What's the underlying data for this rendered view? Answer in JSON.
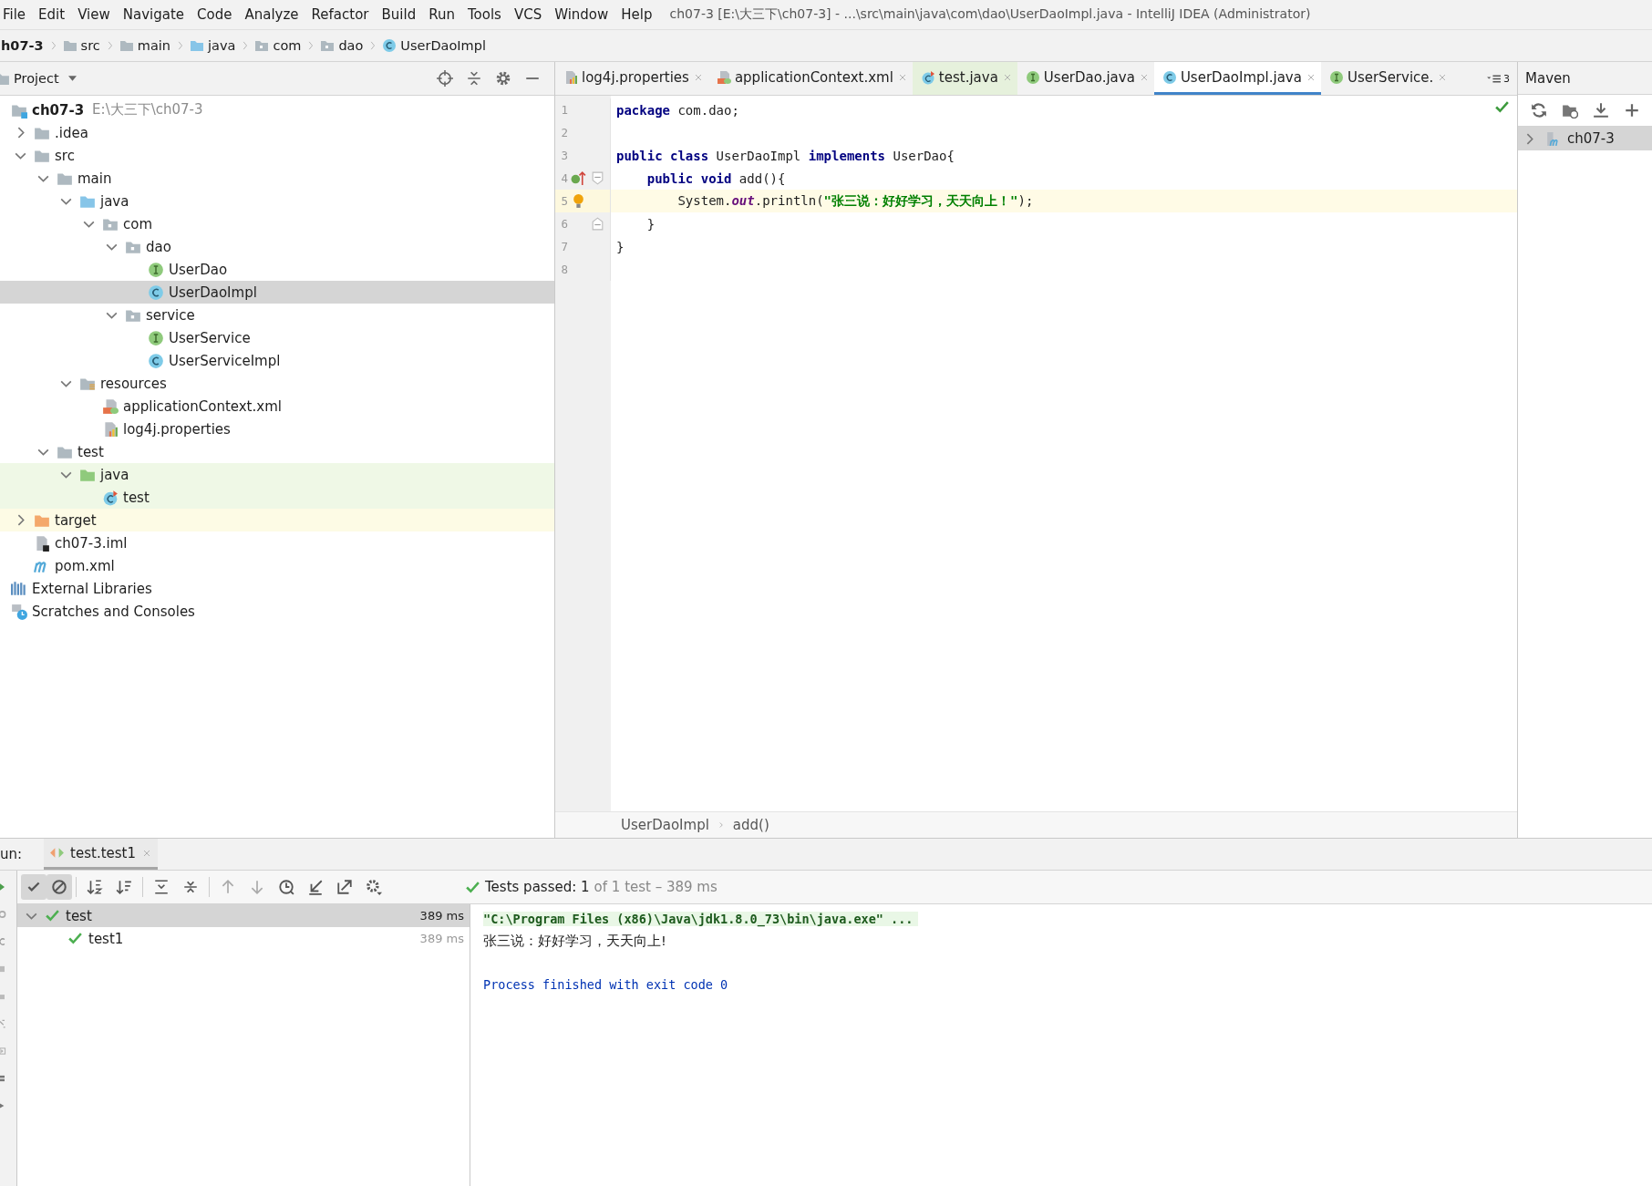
{
  "menu": [
    "File",
    "Edit",
    "View",
    "Navigate",
    "Code",
    "Analyze",
    "Refactor",
    "Build",
    "Run",
    "Tools",
    "VCS",
    "Window",
    "Help"
  ],
  "title": "ch07-3 [E:\\大三下\\ch07-3] - ...\\src\\main\\java\\com\\dao\\UserDaoImpl.java - IntelliJ IDEA (Administrator)",
  "nav_path": [
    {
      "label": "h07-3",
      "kind": "module"
    },
    {
      "label": "src",
      "kind": "folder"
    },
    {
      "label": "main",
      "kind": "folder"
    },
    {
      "label": "java",
      "kind": "source-folder"
    },
    {
      "label": "com",
      "kind": "package"
    },
    {
      "label": "dao",
      "kind": "package"
    },
    {
      "label": "UserDaoImpl",
      "kind": "class"
    }
  ],
  "project_panel": {
    "title": "Project",
    "tree": [
      {
        "label": "ch07-3",
        "path": "E:\\大三下\\ch07-3",
        "kind": "module",
        "selected": false,
        "children": [
          {
            "label": ".idea",
            "kind": "folder",
            "expanded": false,
            "selected": false
          },
          {
            "label": "src",
            "kind": "folder",
            "expanded": true,
            "selected": false,
            "children": [
              {
                "label": "main",
                "kind": "folder",
                "expanded": true,
                "selected": false,
                "children": [
                  {
                    "label": "java",
                    "kind": "source-folder",
                    "expanded": true,
                    "selected": false,
                    "children": [
                      {
                        "label": "com",
                        "kind": "package",
                        "expanded": true,
                        "selected": false,
                        "children": [
                          {
                            "label": "dao",
                            "kind": "package",
                            "expanded": true,
                            "selected": false,
                            "children": [
                              {
                                "label": "UserDao",
                                "kind": "interface",
                                "selected": false
                              },
                              {
                                "label": "UserDaoImpl",
                                "kind": "class",
                                "selected": true
                              }
                            ]
                          },
                          {
                            "label": "service",
                            "kind": "package",
                            "expanded": true,
                            "selected": false,
                            "children": [
                              {
                                "label": "UserService",
                                "kind": "interface",
                                "selected": false
                              },
                              {
                                "label": "UserServiceImpl",
                                "kind": "class",
                                "selected": false
                              }
                            ]
                          }
                        ]
                      }
                    ]
                  },
                  {
                    "label": "resources",
                    "kind": "resource-folder",
                    "expanded": true,
                    "selected": false,
                    "children": [
                      {
                        "label": "applicationContext.xml",
                        "kind": "xml",
                        "selected": false
                      },
                      {
                        "label": "log4j.properties",
                        "kind": "properties",
                        "selected": false
                      }
                    ]
                  }
                ]
              },
              {
                "label": "test",
                "kind": "folder",
                "expanded": true,
                "selected": false,
                "children": [
                  {
                    "label": "java",
                    "kind": "test-folder",
                    "expanded": true,
                    "selected": false,
                    "children": [
                      {
                        "label": "test",
                        "kind": "test-class",
                        "selected": false
                      }
                    ]
                  }
                ]
              }
            ]
          },
          {
            "label": "target",
            "kind": "excluded-folder",
            "expanded": false,
            "selected": false
          },
          {
            "label": "ch07-3.iml",
            "kind": "iml",
            "selected": false
          },
          {
            "label": "pom.xml",
            "kind": "maven",
            "selected": false
          }
        ]
      },
      {
        "label": "External Libraries",
        "kind": "libraries",
        "selected": false
      },
      {
        "label": "Scratches and Consoles",
        "kind": "scratches",
        "selected": false
      }
    ]
  },
  "editor": {
    "tabs": [
      {
        "label": "log4j.properties",
        "kind": "properties",
        "selected": false
      },
      {
        "label": "applicationContext.xml",
        "kind": "xml",
        "selected": false
      },
      {
        "label": "test.java",
        "kind": "test-class",
        "selected": false
      },
      {
        "label": "UserDao.java",
        "kind": "interface",
        "selected": false
      },
      {
        "label": "UserDaoImpl.java",
        "kind": "class",
        "selected": true
      },
      {
        "label": "UserService.",
        "kind": "interface",
        "selected": false
      }
    ],
    "hidden_tabs_count": "3",
    "lines": [
      {
        "number": "1",
        "tokens": [
          {
            "kind": "keyword",
            "text": "package"
          },
          {
            "kind": "plain",
            "text": " com.dao;"
          }
        ]
      },
      {
        "number": "2"
      },
      {
        "number": "3",
        "tokens": [
          {
            "kind": "keyword",
            "text": "public class"
          },
          {
            "kind": "plain",
            "text": " UserDaoImpl "
          },
          {
            "kind": "keyword",
            "text": "implements"
          },
          {
            "kind": "plain",
            "text": " UserDao{"
          }
        ]
      },
      {
        "number": "4",
        "implements_marker": true,
        "fold_start": true,
        "tokens": [
          {
            "kind": "keyword",
            "text": "    public void"
          },
          {
            "kind": "plain",
            "text": " add(){"
          }
        ]
      },
      {
        "number": "5",
        "highlighted": true,
        "bulb": true,
        "tokens": [
          {
            "kind": "plain",
            "text": "        System."
          },
          {
            "kind": "static",
            "text": "out"
          },
          {
            "kind": "plain",
            "text": ".println("
          },
          {
            "kind": "string",
            "text": "\"张三说：好好学习，天天向上！\""
          },
          {
            "kind": "plain",
            "text": ");"
          }
        ]
      },
      {
        "number": "6",
        "fold_end": true,
        "tokens": [
          {
            "kind": "plain",
            "text": "    }"
          }
        ]
      },
      {
        "number": "7",
        "tokens": [
          {
            "kind": "plain",
            "text": "}"
          }
        ]
      },
      {
        "number": "8"
      }
    ],
    "breadcrumbs": [
      "UserDaoImpl",
      "add()"
    ]
  },
  "maven_panel": {
    "title": "Maven",
    "tree": [
      {
        "label": "ch07-3",
        "expanded": false,
        "selected": true
      }
    ]
  },
  "run_panel": {
    "label": "un:",
    "tabs": [
      {
        "label": "test.test1",
        "selected": true
      }
    ],
    "toggles": [
      {
        "kind": "check",
        "on": true
      },
      {
        "kind": "ignored",
        "on": true
      }
    ],
    "status": "Tests passed: 1",
    "status_detail": "of 1 test – 389 ms",
    "tests": [
      {
        "label": "test",
        "time": "389 ms",
        "expanded": true,
        "selected": true,
        "children": [
          {
            "label": "test1",
            "time": "389 ms",
            "selected": false
          }
        ]
      }
    ],
    "console": [
      {
        "kind": "command",
        "text": "\"C:\\Program Files (x86)\\Java\\jdk1.8.0_73\\bin\\java.exe\" ..."
      },
      {
        "kind": "output",
        "text": "张三说：好好学习，天天向上!"
      },
      {
        "kind": "exit",
        "text": "Process finished with exit code 0"
      }
    ]
  }
}
